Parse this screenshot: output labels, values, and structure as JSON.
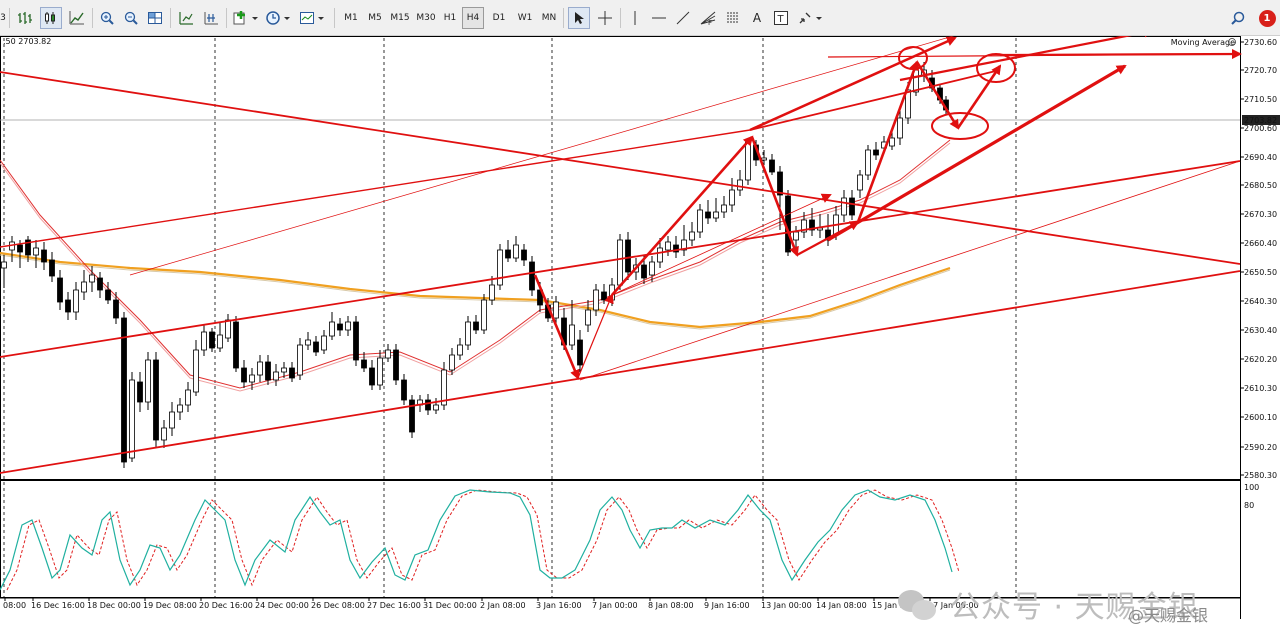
{
  "toolbar": {
    "timeframes": [
      "M1",
      "M5",
      "M15",
      "M30",
      "H1",
      "H4",
      "D1",
      "W1",
      "MN"
    ],
    "active_timeframe": "H4",
    "text_tool": "A",
    "text_label_tool": "T",
    "notification_badge": "1"
  },
  "chart": {
    "header_text": ".50 2703.82",
    "indicator_label": "Moving Average",
    "current_price_label": "2703.82",
    "price_axis": [
      "2730.60",
      "2720.70",
      "2710.50",
      "2700.60",
      "2690.40",
      "2680.50",
      "2670.30",
      "2660.40",
      "2650.50",
      "2640.30",
      "2630.40",
      "2620.20",
      "2610.30",
      "2600.10",
      "2590.20",
      "2580.30"
    ],
    "osc_axis": [
      "100",
      "80"
    ],
    "time_axis": [
      "08:00",
      "16 Dec 16:00",
      "18 Dec 00:00",
      "19 Dec 08:00",
      "20 Dec 16:00",
      "24 Dec 00:00",
      "26 Dec 08:00",
      "27 Dec 16:00",
      "31 Dec 00:00",
      "2 Jan 08:00",
      "3 Jan 16:00",
      "7 Jan 00:00",
      "8 Jan 08:00",
      "9 Jan 16:00",
      "13 Jan 00:00",
      "14 Jan 08:00",
      "15 Jan 16:00",
      "17 Jan 00:00"
    ],
    "colors": {
      "trendline": "#e01010",
      "ma_long": "#f0a020",
      "ma_short": "#e03030",
      "osc_main": "#20b0a0",
      "osc_signal": "#e02020",
      "grid": "#000000"
    }
  },
  "watermark": {
    "text1": "公众号 · 天赐金银",
    "text2": "@天赐金银"
  }
}
